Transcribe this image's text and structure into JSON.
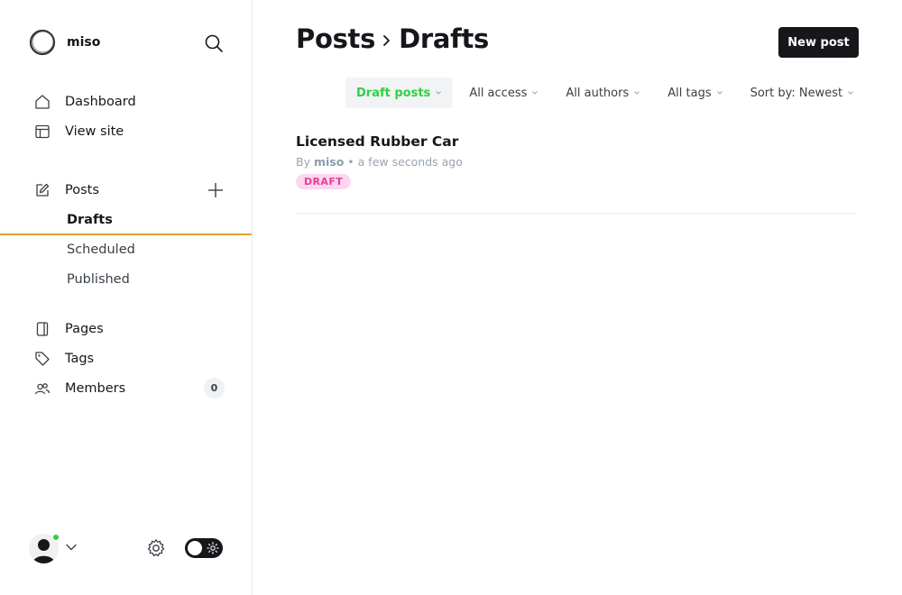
{
  "brand": {
    "name": "miso"
  },
  "sidebar": {
    "nav": [
      {
        "label": "Dashboard",
        "icon": "home-icon"
      },
      {
        "label": "View site",
        "icon": "layout-icon"
      }
    ],
    "posts": {
      "label": "Posts",
      "icon": "edit-icon",
      "sub": [
        {
          "label": "Drafts",
          "active": true
        },
        {
          "label": "Scheduled"
        },
        {
          "label": "Published"
        }
      ]
    },
    "other": [
      {
        "label": "Pages",
        "icon": "page-icon"
      },
      {
        "label": "Tags",
        "icon": "tag-icon"
      },
      {
        "label": "Members",
        "icon": "members-icon",
        "count": "0"
      }
    ]
  },
  "header": {
    "breadcrumb": [
      "Posts",
      "Drafts"
    ],
    "new_post_label": "New post"
  },
  "filters": [
    {
      "label": "Draft posts",
      "selected": true
    },
    {
      "label": "All access"
    },
    {
      "label": "All authors"
    },
    {
      "label": "All tags"
    },
    {
      "label": "Sort by: Newest"
    }
  ],
  "posts": [
    {
      "title": "Licensed Rubber Car",
      "by": "By",
      "author": "miso",
      "separator": "•",
      "time": "a few seconds ago",
      "status": "DRAFT"
    }
  ],
  "colors": {
    "accent_green": "#30cf43",
    "draft_pink": "#e63e96",
    "active_underline": "#e59d36",
    "primary_button": "#15171a"
  }
}
